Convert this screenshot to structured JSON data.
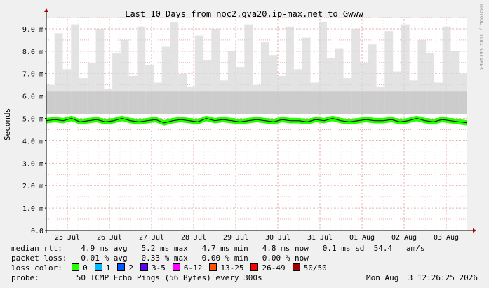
{
  "chart_data": {
    "type": "line",
    "title": "Last 10 Days from noc2.gva20.ip-max.net to Gwww",
    "ylabel": "Seconds",
    "watermark": "RRDTOOL / TOBI OETIKER",
    "ylim": [
      0,
      9.5
    ],
    "y_ticks": [
      "0.0",
      "1.0 m",
      "2.0 m",
      "3.0 m",
      "4.0 m",
      "5.0 m",
      "6.0 m",
      "7.0 m",
      "8.0 m",
      "9.0 m"
    ],
    "y_tick_values": [
      0,
      1,
      2,
      3,
      4,
      5,
      6,
      7,
      8,
      9
    ],
    "x_ticks": [
      "25 Jul",
      "26 Jul",
      "27 Jul",
      "28 Jul",
      "29 Jul",
      "30 Jul",
      "31 Jul",
      "01 Aug",
      "02 Aug",
      "03 Aug"
    ],
    "x_tick_positions_days": [
      0.5,
      1.5,
      2.5,
      3.5,
      4.5,
      5.5,
      6.5,
      7.5,
      8.5,
      9.5
    ],
    "x_range_days": [
      0,
      10
    ],
    "series": [
      {
        "name": "median rtt",
        "unit": "ms",
        "x_days": [
          0.0,
          0.2,
          0.4,
          0.6,
          0.8,
          1.0,
          1.2,
          1.4,
          1.6,
          1.8,
          2.0,
          2.2,
          2.4,
          2.6,
          2.8,
          3.0,
          3.2,
          3.4,
          3.6,
          3.8,
          4.0,
          4.2,
          4.4,
          4.6,
          4.8,
          5.0,
          5.2,
          5.4,
          5.6,
          5.8,
          6.0,
          6.2,
          6.4,
          6.6,
          6.8,
          7.0,
          7.2,
          7.4,
          7.6,
          7.8,
          8.0,
          8.2,
          8.4,
          8.6,
          8.8,
          9.0,
          9.2,
          9.4,
          9.6,
          9.8,
          10.0
        ],
        "values": [
          4.9,
          4.95,
          4.9,
          5.0,
          4.85,
          4.9,
          4.95,
          4.85,
          4.9,
          5.0,
          4.9,
          4.85,
          4.9,
          4.95,
          4.8,
          4.9,
          4.95,
          4.9,
          4.85,
          5.0,
          4.9,
          4.95,
          4.9,
          4.85,
          4.9,
          4.95,
          4.9,
          4.85,
          4.95,
          4.9,
          4.9,
          4.85,
          4.95,
          4.9,
          5.0,
          4.9,
          4.85,
          4.9,
          4.95,
          4.9,
          4.9,
          4.95,
          4.85,
          4.9,
          5.0,
          4.9,
          4.85,
          4.95,
          4.9,
          4.85,
          4.8
        ]
      }
    ],
    "smoke_max_ms": [
      6.5,
      8.8,
      7.2,
      9.2,
      6.8,
      7.5,
      9.0,
      6.3,
      7.9,
      8.5,
      6.9,
      9.1,
      7.4,
      6.6,
      8.2,
      9.3,
      7.0,
      6.4,
      8.7,
      7.6,
      9.0,
      6.7,
      8.0,
      7.3,
      9.2,
      6.5,
      8.4,
      7.8,
      6.9,
      9.1,
      7.2,
      8.6,
      6.6,
      9.3,
      7.7,
      8.1,
      6.8,
      9.0,
      7.5,
      8.3,
      6.4,
      8.9,
      7.1,
      9.2,
      6.7,
      8.5,
      7.9,
      6.6,
      9.1,
      8.0,
      7.0
    ]
  },
  "legend": {
    "stats": {
      "label": "median rtt:",
      "avg": "4.9 ms avg",
      "max": "5.2 ms max",
      "min": "4.7 ms min",
      "now": "4.8 ms now",
      "sd": "0.1 ms sd",
      "am": "54.4   am/s"
    },
    "loss": {
      "label": "packet loss:",
      "avg": "0.01 % avg",
      "max": "0.33 % max",
      "min": "0.00 % min",
      "now": "0.00 % now"
    },
    "loss_color_label": "loss color:",
    "loss_colors": [
      {
        "label": "0",
        "color": "#26ff00"
      },
      {
        "label": "1",
        "color": "#00b8ff"
      },
      {
        "label": "2",
        "color": "#0059ff"
      },
      {
        "label": "3-5",
        "color": "#5e00ff"
      },
      {
        "label": "6-12",
        "color": "#ff00ff"
      },
      {
        "label": "13-25",
        "color": "#ff5500"
      },
      {
        "label": "26-49",
        "color": "#ff0000"
      },
      {
        "label": "50/50",
        "color": "#a10000"
      }
    ],
    "probe_label": "probe:",
    "probe_text": "50 ICMP Echo Pings (56 Bytes) every 300s",
    "timestamp": "Mon Aug  3 12:26:25 2026"
  },
  "colors": {
    "background": "#f0f0f0",
    "plot": "#ffffff",
    "grid": "#e0a0a0",
    "median": "#000000",
    "band": "#26ff00",
    "smoke": "#d9d9d9"
  }
}
